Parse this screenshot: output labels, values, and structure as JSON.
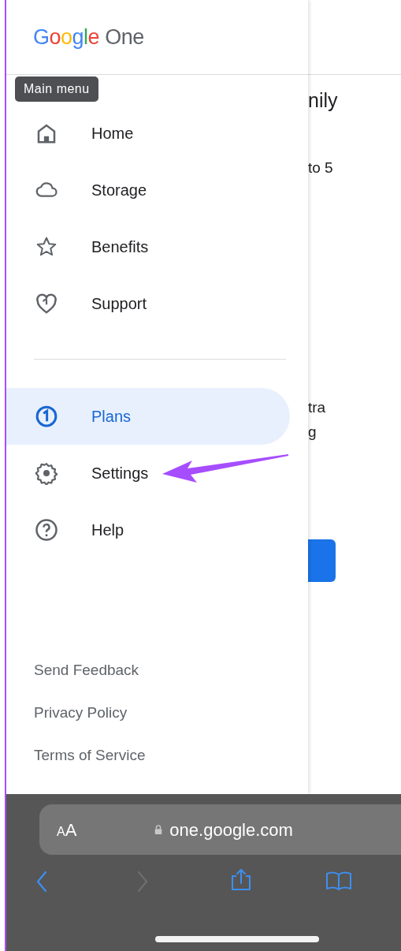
{
  "drawer": {
    "logo": {
      "brand": "Google",
      "product": "One"
    },
    "tooltip": "Main menu",
    "items": [
      {
        "label": "Home",
        "selected": false
      },
      {
        "label": "Storage",
        "selected": false
      },
      {
        "label": "Benefits",
        "selected": false
      },
      {
        "label": "Support",
        "selected": false
      },
      {
        "label": "Plans",
        "selected": true
      },
      {
        "label": "Settings",
        "selected": false
      },
      {
        "label": "Help",
        "selected": false
      }
    ],
    "footer_links": [
      "Send Feedback",
      "Privacy Policy",
      "Terms of Service"
    ]
  },
  "background_page": {
    "texts": [
      "nily",
      "to 5",
      "tra",
      "g"
    ]
  },
  "browser": {
    "text_size_button": "AA",
    "url": "one.google.com",
    "toolbar": [
      {
        "kind": "back",
        "disabled": false
      },
      {
        "kind": "forward",
        "disabled": true
      },
      {
        "kind": "share",
        "disabled": false
      },
      {
        "kind": "bookmarks",
        "disabled": false
      }
    ]
  }
}
